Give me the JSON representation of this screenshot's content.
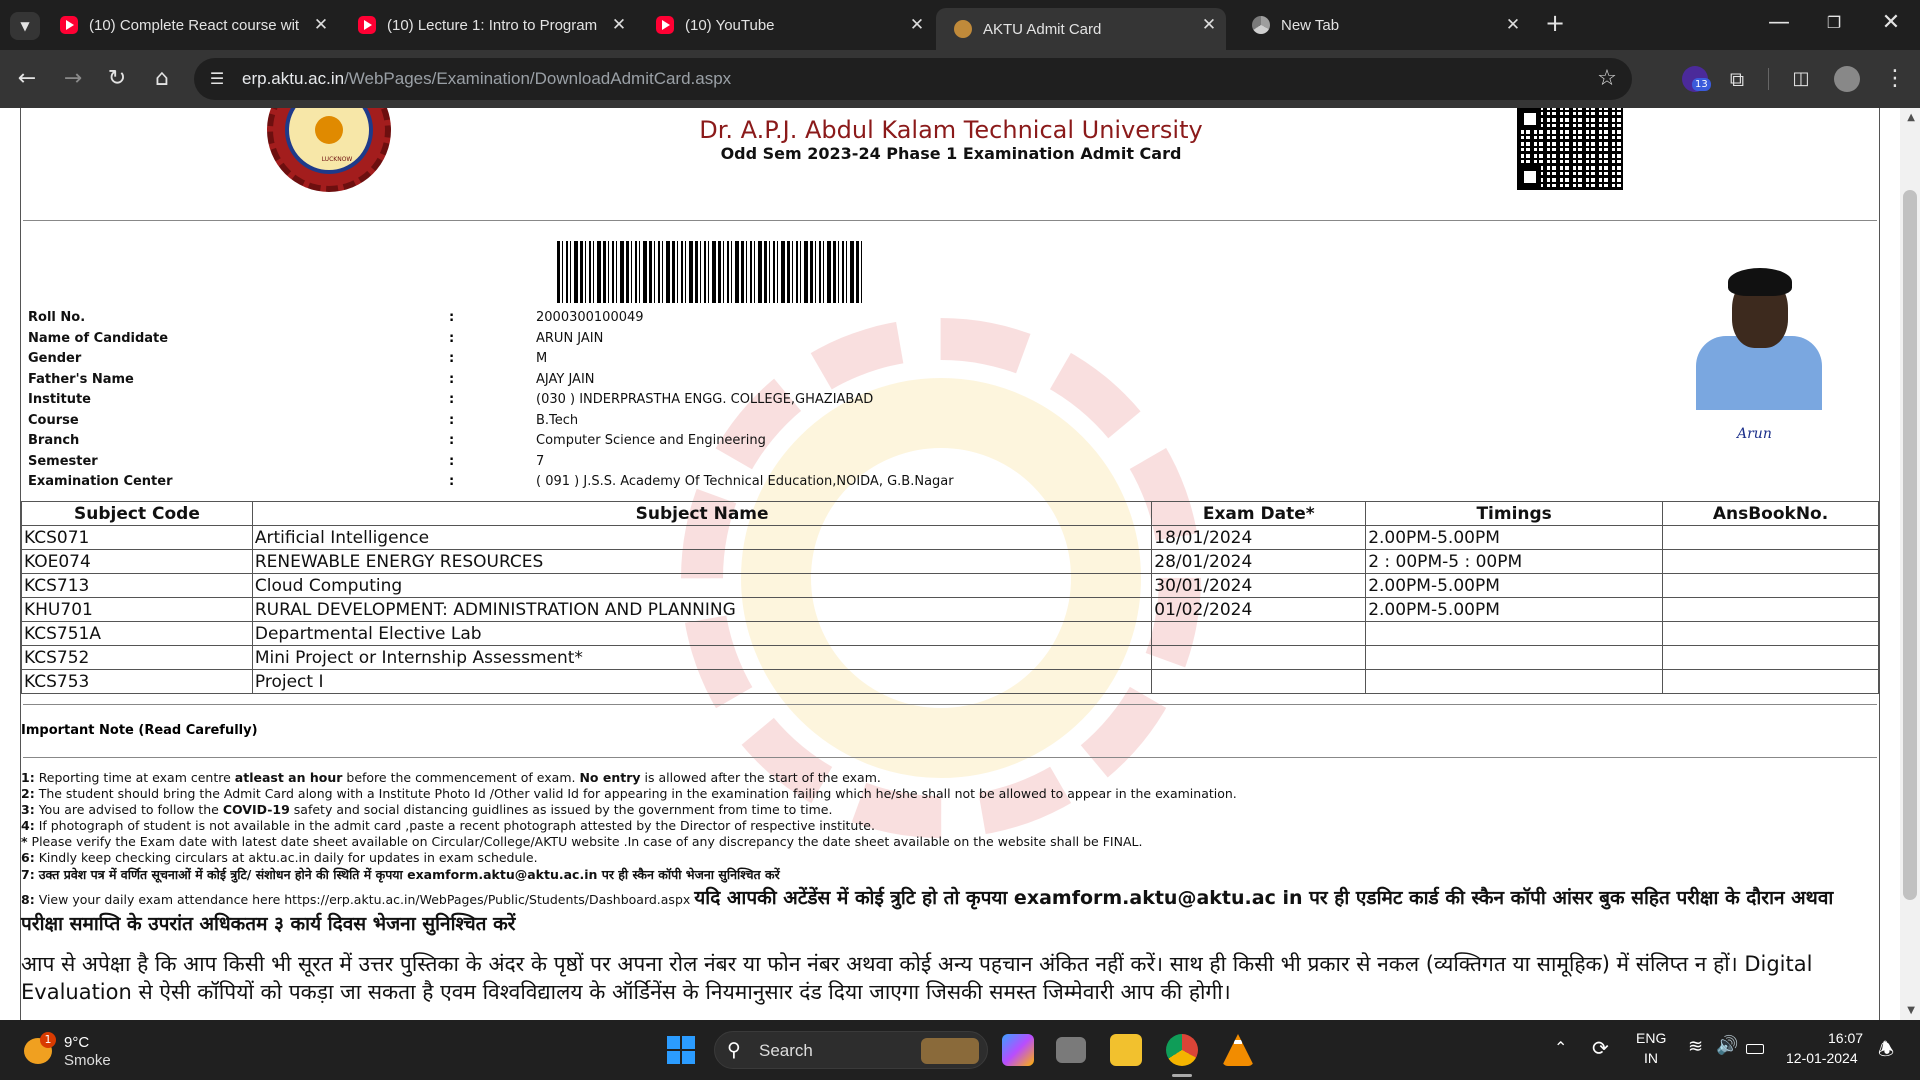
{
  "browser": {
    "tabs": [
      {
        "title": "(10) Complete React course wit",
        "type": "youtube"
      },
      {
        "title": "(10) Lecture 1: Intro to Program",
        "type": "youtube"
      },
      {
        "title": "(10) YouTube",
        "type": "youtube"
      },
      {
        "title": "AKTU Admit Card",
        "type": "site",
        "active": true
      },
      {
        "title": "New Tab",
        "type": "newtab"
      }
    ],
    "new_tab_symbol": "+",
    "url_host": "erp.aktu.ac.in",
    "url_path": "/WebPages/Examination/DownloadAdmitCard.aspx",
    "extension_badge": "13"
  },
  "admit_card": {
    "university": "Dr. A.P.J. Abdul Kalam Technical University",
    "exam_title": "Odd Sem 2023-24 Phase 1 Examination Admit Card",
    "logo_word": "LUCKNOW",
    "fields": [
      {
        "label": "Roll No.",
        "value": "2000300100049"
      },
      {
        "label": "Name of Candidate",
        "value": "ARUN JAIN"
      },
      {
        "label": "Gender",
        "value": "M"
      },
      {
        "label": "Father's Name",
        "value": "AJAY JAIN"
      },
      {
        "label": "Institute",
        "value": "(030 ) INDERPRASTHA ENGG. COLLEGE,GHAZIABAD"
      },
      {
        "label": "Course",
        "value": "B.Tech"
      },
      {
        "label": "Branch",
        "value": "Computer Science and Engineering"
      },
      {
        "label": "Semester",
        "value": "7"
      },
      {
        "label": "Examination Center",
        "value": "( 091 ) J.S.S. Academy Of Technical Education,NOIDA, G.B.Nagar"
      }
    ],
    "colon": ":",
    "signature": "Arun",
    "table_headers": [
      "Subject Code",
      "Subject Name",
      "Exam Date*",
      "Timings",
      "AnsBookNo."
    ],
    "subjects": [
      [
        "KCS071",
        "Artificial Intelligence",
        "18/01/2024",
        "2.00PM-5.00PM",
        ""
      ],
      [
        "KOE074",
        "RENEWABLE ENERGY RESOURCES",
        "28/01/2024",
        "2 : 00PM-5 : 00PM",
        ""
      ],
      [
        "KCS713",
        "Cloud Computing",
        "30/01/2024",
        "2.00PM-5.00PM",
        ""
      ],
      [
        "KHU701",
        "RURAL DEVELOPMENT: ADMINISTRATION AND PLANNING",
        "01/02/2024",
        "2.00PM-5.00PM",
        ""
      ],
      [
        "KCS751A",
        "Departmental Elective Lab",
        "",
        "",
        ""
      ],
      [
        "KCS752",
        "Mini Project or Internship Assessment*",
        "",
        "",
        ""
      ],
      [
        "KCS753",
        "Project I",
        "",
        "",
        ""
      ]
    ],
    "important_heading": "Important Note (Read Carefully)",
    "notes": [
      {
        "num": "1:",
        "parts": [
          [
            "Reporting time at exam centre ",
            false
          ],
          [
            "atleast an hour",
            true
          ],
          [
            " before the commencement of exam. ",
            false
          ],
          [
            "No entry",
            true
          ],
          [
            " is allowed after the start of the exam.",
            false
          ]
        ]
      },
      {
        "num": "2:",
        "parts": [
          [
            "The student should bring the Admit Card along with a Institute Photo Id /Other valid Id for appearing in the examination failing which he/she shall not be allowed to appear in the examination.",
            false
          ]
        ]
      },
      {
        "num": "3:",
        "parts": [
          [
            "You are advised to follow the ",
            false
          ],
          [
            "COVID-19",
            true
          ],
          [
            " safety and social distancing guidlines as issued by the government from time to time.",
            false
          ]
        ]
      },
      {
        "num": "4:",
        "parts": [
          [
            "If photograph of student is not available in the admit card ,paste a recent photograph attested by the Director of respective institute.",
            false
          ]
        ]
      },
      {
        "num": "*",
        "parts": [
          [
            "Please verify the Exam date with latest date sheet available on Circular/College/AKTU website .In case of any discrepancy the date sheet available on the website shall be FINAL.",
            false
          ]
        ]
      },
      {
        "num": "6:",
        "parts": [
          [
            "Kindly keep checking circulars at aktu.ac.in daily for updates in exam schedule.",
            false
          ]
        ]
      },
      {
        "num": "7:",
        "parts": [
          [
            "उक्त प्रवेश पत्र में वर्णित सूचनाओं में कोई त्रुटि/ संशोधन होने की स्थिति में कृपया examform.aktu@aktu.ac.in पर ही स्कैन कॉपी भेजना सुनिश्चित करें",
            true
          ]
        ]
      }
    ],
    "note8_num": "8:",
    "note8_small": "View your daily exam attendance here https://erp.aktu.ac.in/WebPages/Public/Students/Dashboard.aspx",
    "note8_big": "यदि आपकी अटेंडेंस में कोई त्रुटि हो तो कृपया examform.aktu@aktu.ac in पर ही एडमिट कार्ड की स्कैन कॉपी आंसर बुक सहित परीक्षा के दौरान अथवा परीक्षा समाप्ति के उपरांत अधिकतम ३ कार्य दिवस भेजना सुनिश्चित करें",
    "hindi_para": "आप से अपेक्षा है कि आप किसी भी सूरत में उत्तर पुस्तिका के अंदर के पृष्ठों पर अपना रोल नंबर या फोन नंबर अथवा कोई अन्य पहचान अंकित नहीं करें। साथ ही किसी भी प्रकार से नकल (व्यक्तिगत या सामूहिक) में संलिप्त न हों। Digital Evaluation से ऐसी कॉपियों को पकड़ा जा सकता है एवम विश्वविद्यालय के ऑर्डिनेंस के नियमानुसार दंड दिया जाएगा जिसकी समस्त जिम्मेवारी आप की होगी।"
  },
  "taskbar": {
    "weather_temp": "9°C",
    "weather_desc": "Smoke",
    "weather_badge": "1",
    "search_label": "Search",
    "lang_top": "ENG",
    "lang_bottom": "IN",
    "time": "16:07",
    "date": "12-01-2024"
  }
}
